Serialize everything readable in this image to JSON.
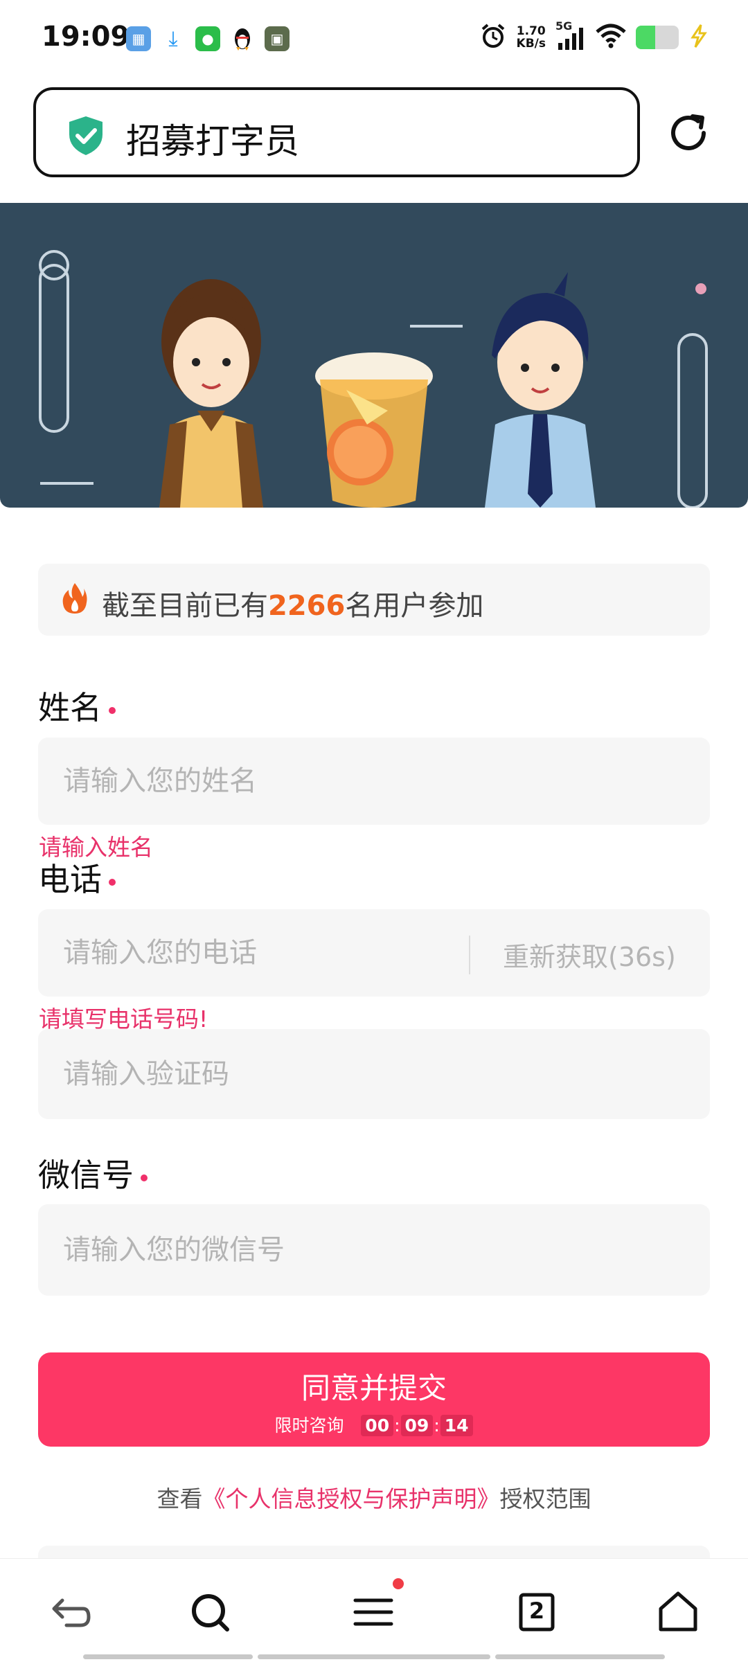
{
  "status_bar": {
    "time": "19:09",
    "net_speed_value": "1.70",
    "net_speed_unit": "KB/s",
    "network": "5G",
    "battery_level": 0.45,
    "app_icons": [
      "game-app-icon",
      "download-icon",
      "wechat-icon",
      "qq-penguin-icon",
      "game2-app-icon"
    ]
  },
  "address_bar": {
    "title": "招募打字员",
    "secure_icon": "shield-check-icon",
    "reload_icon": "reload-icon"
  },
  "counter": {
    "prefix": "截至目前已有",
    "count": "2266",
    "suffix": "名用户参加"
  },
  "form": {
    "name": {
      "label": "姓名",
      "placeholder": "请输入您的姓名",
      "error": "请输入姓名"
    },
    "phone": {
      "label": "电话",
      "placeholder": "请输入您的电话",
      "resend": "重新获取(36s)",
      "error": "请填写电话号码!"
    },
    "code": {
      "placeholder": "请输入验证码"
    },
    "wechat": {
      "label": "微信号",
      "placeholder": "请输入您的微信号"
    }
  },
  "submit": {
    "label": "同意并提交",
    "sub_prefix": "限时咨询",
    "countdown": [
      "00",
      "09",
      "14"
    ]
  },
  "privacy": {
    "prefix": "查看",
    "link": "《个人信息授权与保护声明》",
    "suffix": "授权范围"
  },
  "bottom_nav": {
    "tabs_count": "2"
  },
  "colors": {
    "accent": "#fd3765",
    "count_highlight": "#f0641e",
    "error": "#e8326a",
    "banner_bg": "#324a5c"
  }
}
